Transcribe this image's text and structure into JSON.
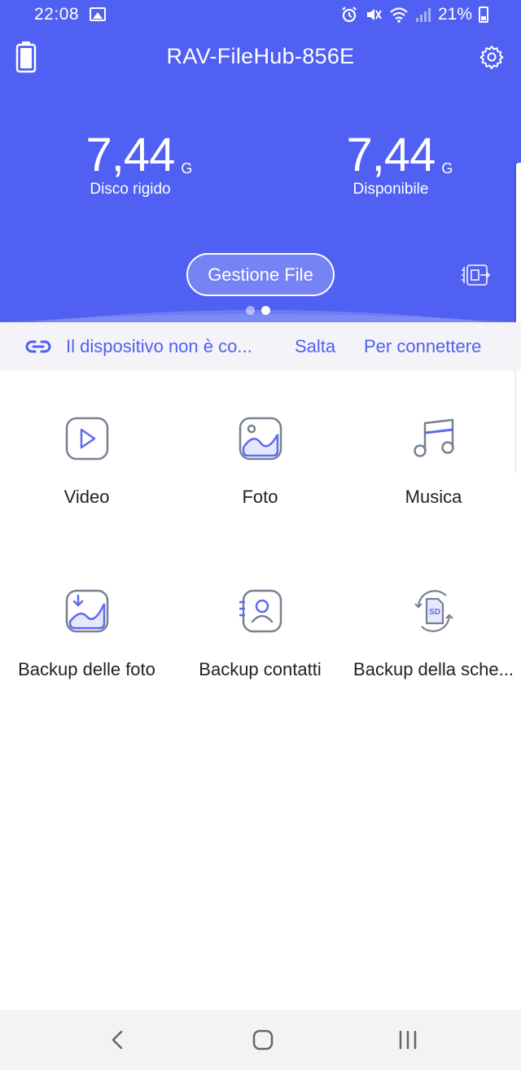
{
  "status_bar": {
    "time": "22:08",
    "battery_percent": "21%"
  },
  "header": {
    "title": "RAV-FileHub-856E",
    "storage": [
      {
        "value": "7,44",
        "unit": "G",
        "label": "Disco rigido"
      },
      {
        "value": "7,44",
        "unit": "G",
        "label": "Disponibile"
      }
    ],
    "file_button_label": "Gestione File",
    "page_dots": {
      "count": 2,
      "active": 1
    }
  },
  "connection": {
    "message": "Il dispositivo non è co...",
    "skip_label": "Salta",
    "connect_label": "Per connettere"
  },
  "grid": {
    "items": [
      {
        "label": "Video",
        "icon": "video-play-icon"
      },
      {
        "label": "Foto",
        "icon": "photo-icon"
      },
      {
        "label": "Musica",
        "icon": "music-note-icon"
      },
      {
        "label": "Backup delle foto",
        "icon": "photo-backup-icon"
      },
      {
        "label": "Backup contatti",
        "icon": "contacts-backup-icon"
      },
      {
        "label": "Backup della sche...",
        "icon": "sd-card-backup-icon"
      }
    ]
  },
  "colors": {
    "accent": "#4f60f2",
    "icon_stroke": "#7a8090",
    "icon_accent": "#5b6bf0"
  }
}
